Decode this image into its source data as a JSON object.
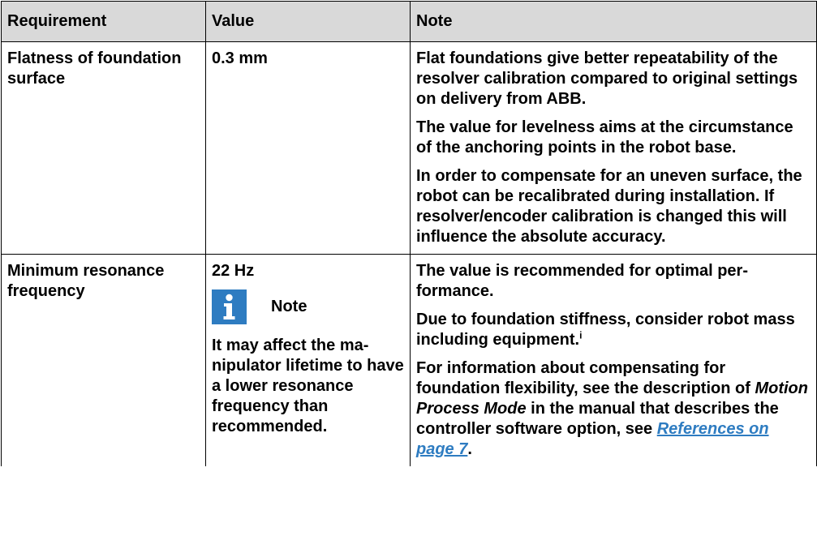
{
  "headers": {
    "requirement": "Requirement",
    "value": "Value",
    "note": "Note"
  },
  "rows": [
    {
      "requirement": "Flatness of foundation surface",
      "value": "0.3 mm",
      "notes": [
        "Flat foundations give better repeatability of the resolver calibration compared to original settings on delivery from ABB.",
        "The value for levelness aims at the circum­stance of the anchoring points in the robot base.",
        "In order to compensate for an uneven sur­face, the robot can be recalibrated during in­stallation. If resolver/encoder calibration is changed this will influence the absolute ac­curacy."
      ]
    },
    {
      "requirement": "Minimum resonance frequency",
      "value": "22 Hz",
      "note_box": {
        "icon": "info-icon",
        "label": "Note",
        "text": "It may affect the ma­nipulator lifetime to have a lower reson­ance frequency than recommended."
      },
      "notes": [
        "The value is recommended for optimal per­formance.",
        "Due to foundation stiffness, consider robot mass including equipment."
      ],
      "footnote_marker": "i",
      "note3_prefix": "For information about compensating for foundation flexibility, see the description of ",
      "note3_italic": "Motion Process Mode",
      "note3_middle": " in the manual that de­scribes the controller software option, see ",
      "note3_link": "References on page 7",
      "note3_suffix": "."
    }
  ],
  "colors": {
    "header_bg": "#d9d9d9",
    "accent_blue": "#2e7cc1",
    "border": "#000000"
  }
}
